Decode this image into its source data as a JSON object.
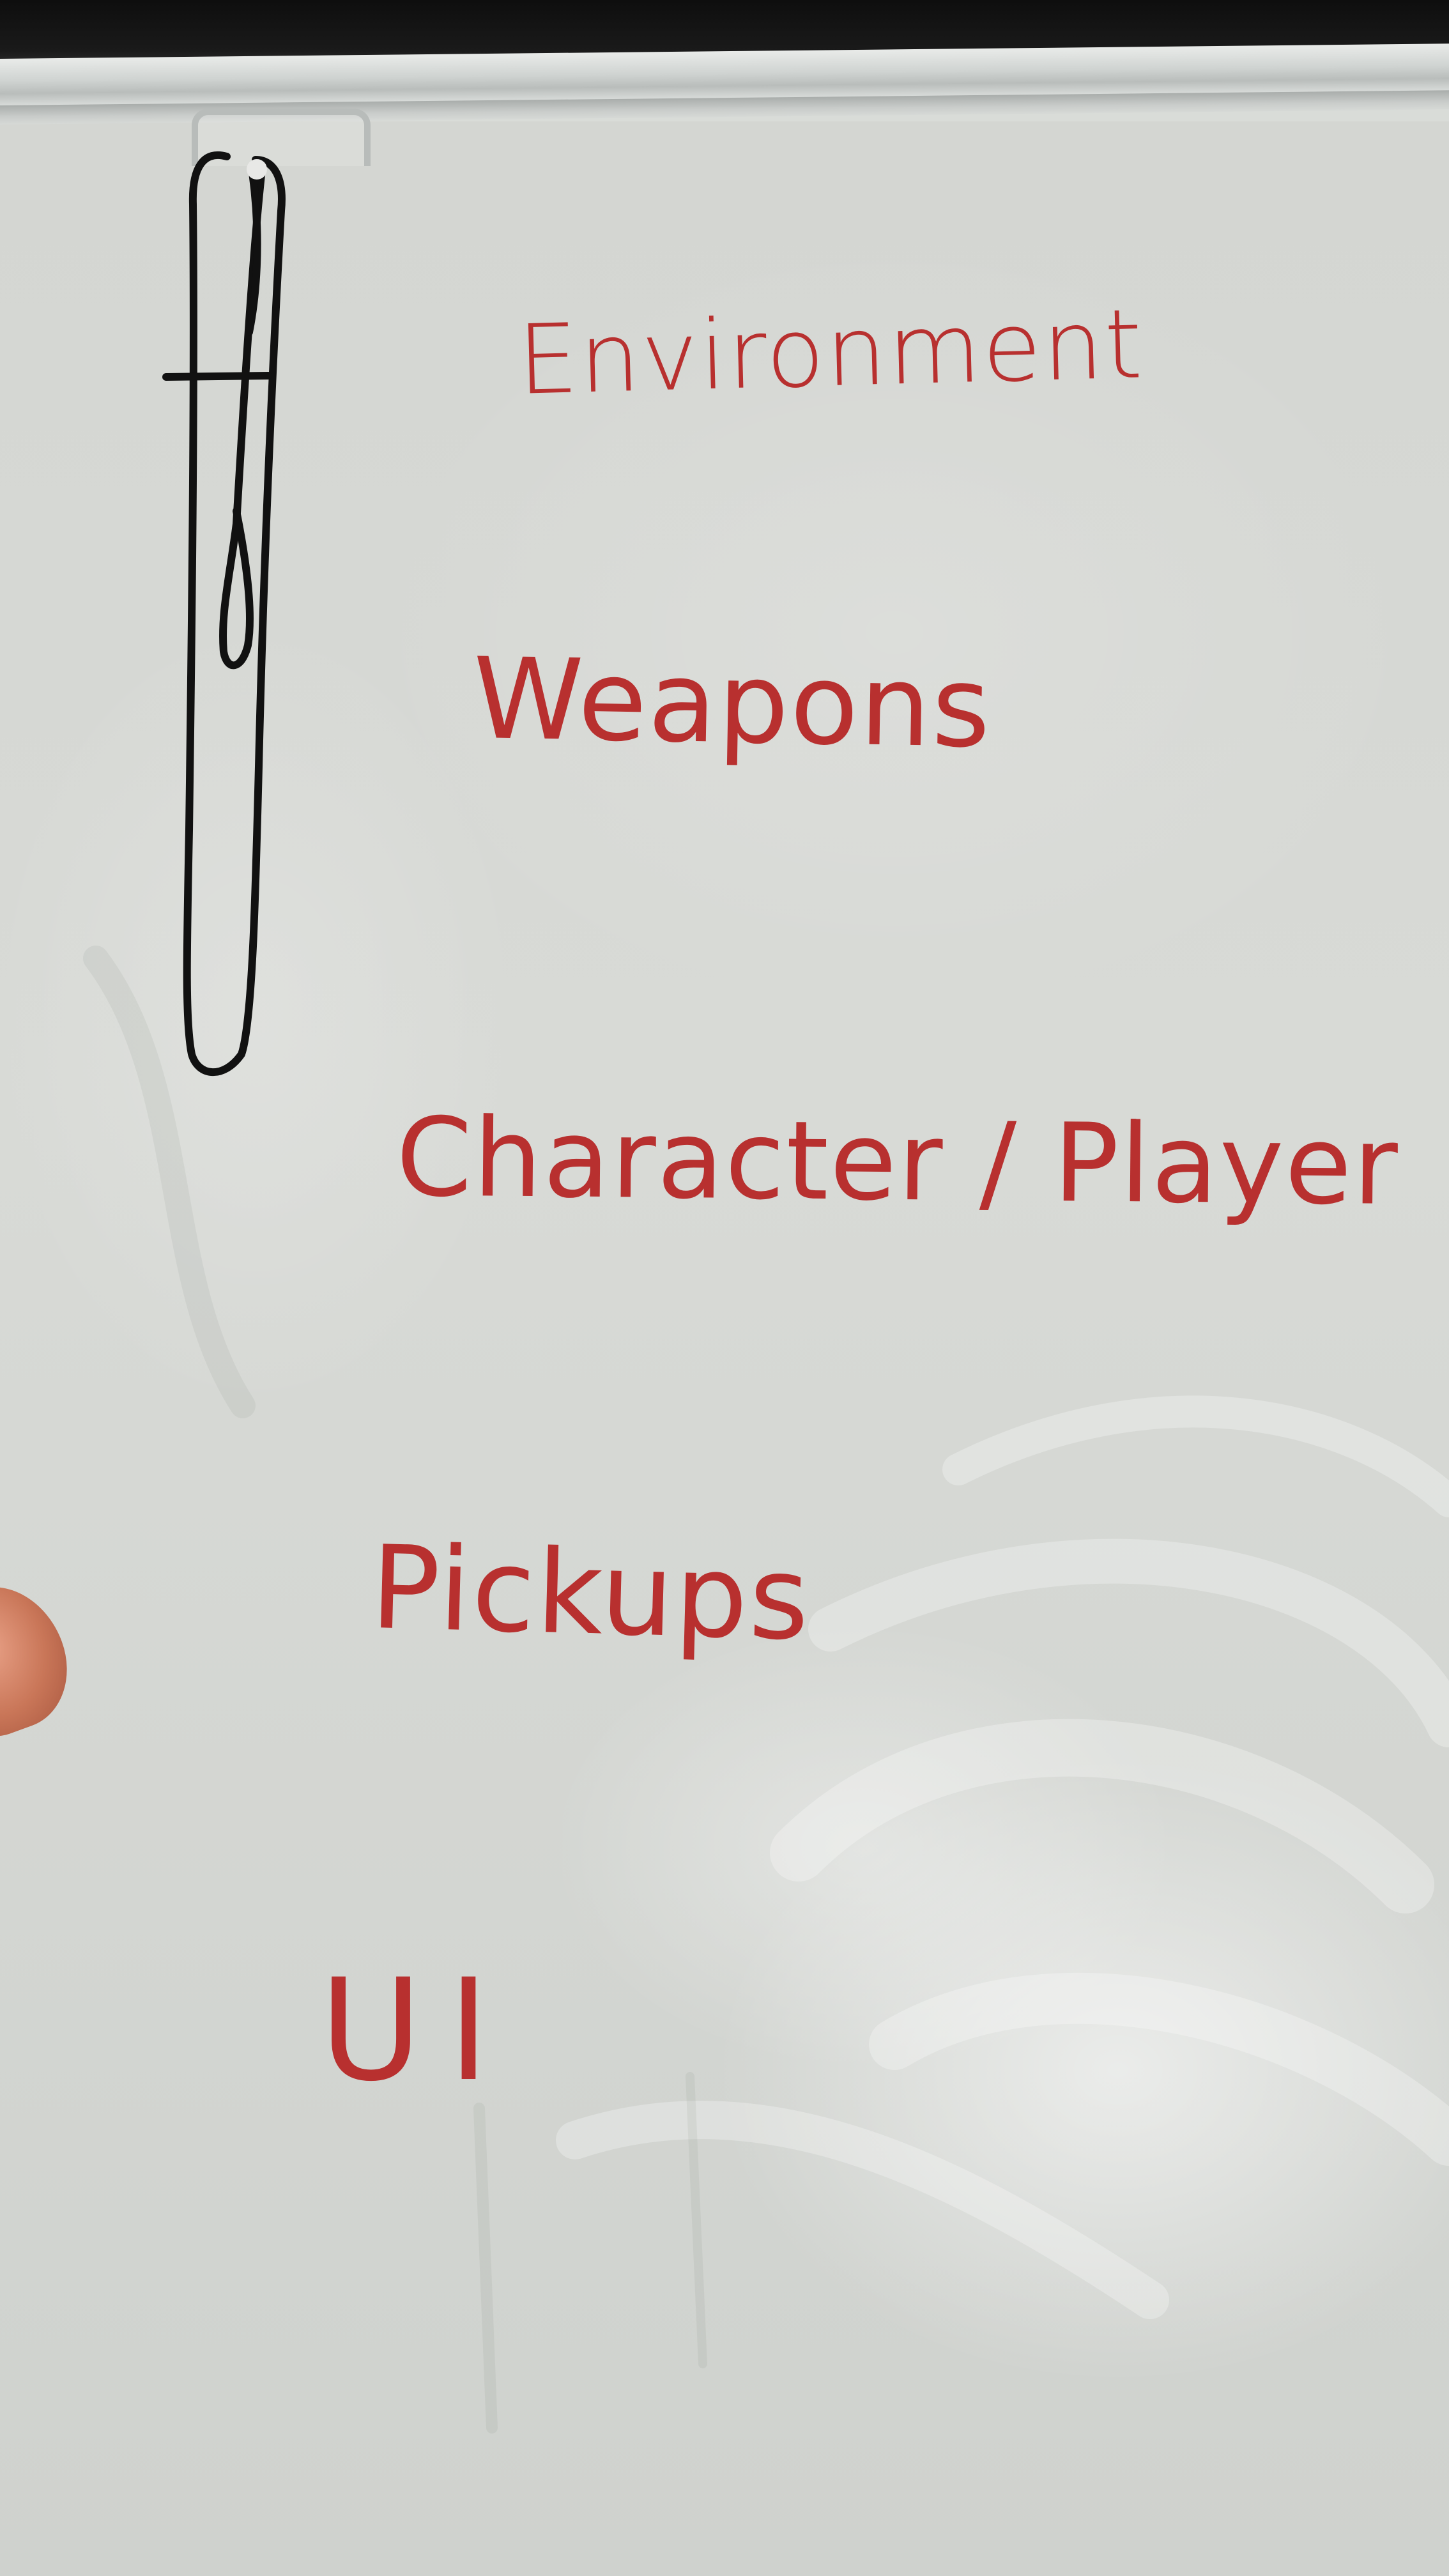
{
  "board": {
    "items": [
      {
        "label": "Environment"
      },
      {
        "label": "Weapons"
      },
      {
        "label": "Character / Player"
      },
      {
        "label": "Pickups"
      },
      {
        "label": "UI"
      }
    ]
  },
  "colors": {
    "marker_ink": "#b8302f",
    "board_surface": "#d8dad6",
    "cord": "#111111",
    "frame": "#111111"
  }
}
